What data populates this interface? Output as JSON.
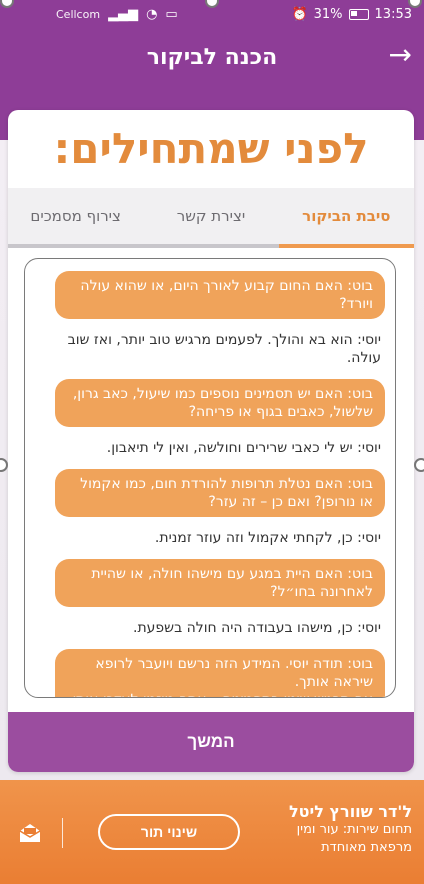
{
  "status_bar": {
    "carrier": "Cellcom",
    "battery": "31%",
    "time": "13:53"
  },
  "header": {
    "title": "הכנה לביקור",
    "back_icon": "arrow-right-icon"
  },
  "main": {
    "heading": "לפני שמתחילים:",
    "tabs": [
      {
        "label": "סיבת הביקור",
        "active": true
      },
      {
        "label": "יצירת קשר",
        "active": false
      },
      {
        "label": "צירוף מסמכים",
        "active": false
      }
    ],
    "messages": [
      {
        "type": "bot",
        "text": "בוט: האם החום קבוע לאורך היום, או שהוא עולה ויורד?"
      },
      {
        "type": "user",
        "text": "יוסי: הוא בא והולך. לפעמים מרגיש טוב יותר, ואז שוב עולה."
      },
      {
        "type": "bot",
        "text": "בוט: האם יש תסמינים נוספים כמו שיעול, כאב גרון, שלשול, כאבים בגוף או פריחה?"
      },
      {
        "type": "user",
        "text": "יוסי: יש לי כאבי שרירים וחולשה, ואין לי תיאבון."
      },
      {
        "type": "bot",
        "text": "בוט: האם נטלת תרופות להורדת חום, כמו אקמול או נורופן? ואם כן – זה עזר?"
      },
      {
        "type": "user",
        "text": "יוסי: כן, לקחתי אקמול וזה עוזר זמנית."
      },
      {
        "type": "bot",
        "text": "בוט: האם היית במגע עם מישהו חולה, או שהיית לאחרונה בחו״ל?"
      },
      {
        "type": "user",
        "text": "יוסי: כן, מישהו בעבודה היה חולה בשפעת."
      },
      {
        "type": "bot",
        "text": "בוט: תודה יוסי. המידע הזה נרשם ויועבר לרופא שיראה אותך.\nאם תרגיש שינוי בתסמינים – אתה מוזמן לעדכן אותי."
      }
    ],
    "continue_label": "המשך"
  },
  "doctor_bar": {
    "name": "ל'דר שוורץ ליטל",
    "service_line": "תחום שירות: עור ומין",
    "clinic": "מרפאת מאוחדת",
    "change_label": "שינוי תור",
    "mail_icon": "mail-open-icon"
  }
}
